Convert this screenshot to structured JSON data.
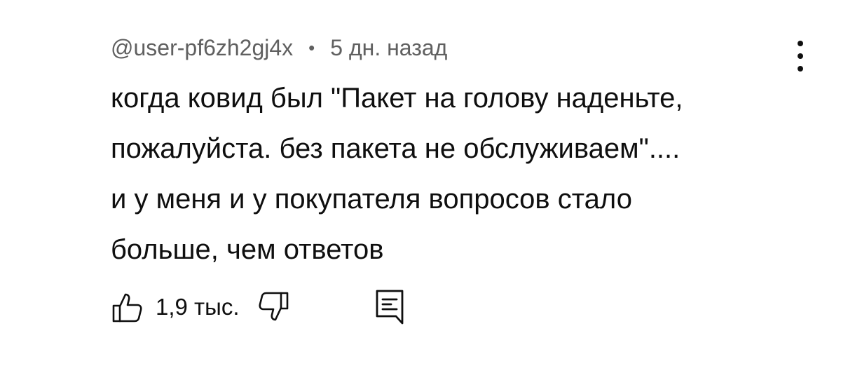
{
  "comment": {
    "author": "@user-pf6zh2gj4x",
    "separator": "•",
    "time": "5 дн. назад",
    "text_lines": [
      "когда ковид был \"Пакет на голову наденьте,",
      "пожалуйста. без пакета не обслуживаем\"....",
      "и у меня и у покупателя вопросов стало",
      "больше, чем ответов"
    ]
  },
  "actions": {
    "like_count": "1,9 тыс."
  },
  "icons": {
    "like": "thumbs-up-icon",
    "dislike": "thumbs-down-icon",
    "reply": "reply-icon",
    "menu": "more-vertical-icon"
  }
}
